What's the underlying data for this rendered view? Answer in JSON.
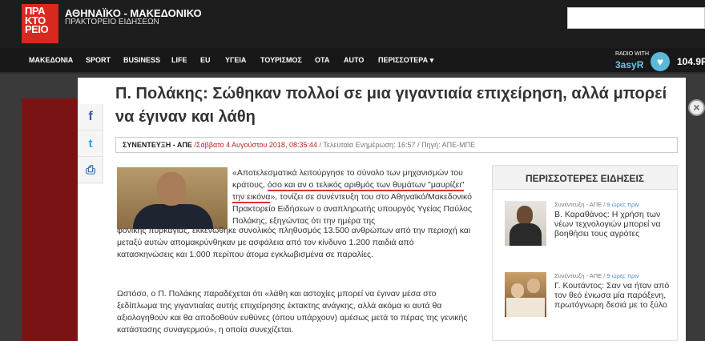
{
  "header": {
    "logo_text": "ΠΡΑΚΤΟΡΕΙΟ",
    "logo_lines": [
      "ΠΡΑ",
      "ΚΤΟ",
      "ΡΕΙΟ"
    ],
    "brand": "ΑΘΗΝΑΪΚΟ - ΜΑΚΕΔΟΝΙΚΟ",
    "brand_sub": "ΠΡΑΚΤΟΡΕΙΟ ΕΙΔΗΣΕΩΝ",
    "brand_color": "#d9281f"
  },
  "nav": {
    "items": [
      "ΜΑΚΕΔΟΝΙΑ",
      "SPORT",
      "BUSINESS",
      "LIFE",
      "EU",
      "ΥΓΕΙΑ",
      "ΤΟΥΡΙΣΜΟΣ",
      "ΟΤΑ",
      "AUTO",
      "ΠΕΡΙΣΣΟΤΕΡΑ"
    ],
    "more_icon": "caret-down-icon",
    "radio_small": "RADIO WITH",
    "radio_name": "3asyR",
    "radio_freq": "104.9F"
  },
  "share": {
    "icons": [
      "facebook-icon",
      "twitter-icon",
      "print-icon"
    ],
    "fb": "f",
    "tw": "t",
    "pr": "⎙"
  },
  "article": {
    "title": "Π. Πολάκης: Σώθηκαν πολλοί σε μια γιγαντιαία επιχείρηση, αλλά μπορεί να έγιναν και λάθη",
    "tag": "ΣΥΝΕΝΤΕΥΞΗ - ΑΠΕ",
    "date": "/Σάββατο 4 Αυγούστου 2018, 08:35:44",
    "updated": "/ Τελευταία Ενημέρωση: 16:57",
    "source": "/ Πηγή: ΑΠΕ-ΜΠΕ",
    "p1_pre": "«Αποτελεσματικά λειτούργησε το σύνολο των μηχανισμών του κράτους, ",
    "p1_hl": "όσο και αν ο τελικός αριθμός των θυμάτων \"μαυρίζει\" την εικόνα",
    "p1_post": "», τονίζει σε συνέντευξη του στο Αθηναϊκό/Μακεδονικό Πρακτορείο Ειδήσεων ο αναπληρωτής υπουργός Υγείας Παύλος Πολάκης, εξηγώντας ότι την ημέρα της",
    "p1_cont": "φονικής πυρκαγιάς, εκκενώθηκε συνολικός πληθυσμός 13.500 ανθρώπων από την περιοχή και μεταξύ αυτών απομακρύνθηκαν με ασφάλεια από τον κίνδυνο 1.200 παιδιά από κατασκηνώσεις και 1.000 περίπου άτομα εγκλωβισμένα σε παραλίες.",
    "p2": "Ωστόσο, ο Π. Πολάκης παραδέχεται ότι «λάθη και αστοχίες μπορεί να έγιναν μέσα στο ξεδίπλωμα της γιγαντιαίας αυτής επιχείρησης έκτακτης ανάγκης, αλλά ακόμα κι αυτά θα αξιολογηθούν και θα αποδοθούν ευθύνες (όπου υπάρχουν) αμέσως μετά το πέρας της γενικής κατάστασης συναγερμού», η οποία συνεχίζεται."
  },
  "sidebar": {
    "heading": "ΠΕΡΙΣΣΟΤΕΡΕΣ ΕΙΔΗΣΕΙΣ",
    "items": [
      {
        "source": "Συνέντευξη - ΑΠΕ",
        "time": " / 9 ώρες πριν",
        "title": "Β. Καραθάνος: Η χρήση των νέων τεχνολογιών μπορεί να βοηθήσει τους αγρότες"
      },
      {
        "source": "Συνέντευξη - ΑΠΕ",
        "time": " / 9 ώρες πριν",
        "title": "Γ. Κουτάντος: Σαν να ήταν από τον θεό ένιωσα μία παράξενη, πρωτόγνωρη δεσιά με το ξύλο"
      }
    ]
  },
  "close_icon": "×"
}
